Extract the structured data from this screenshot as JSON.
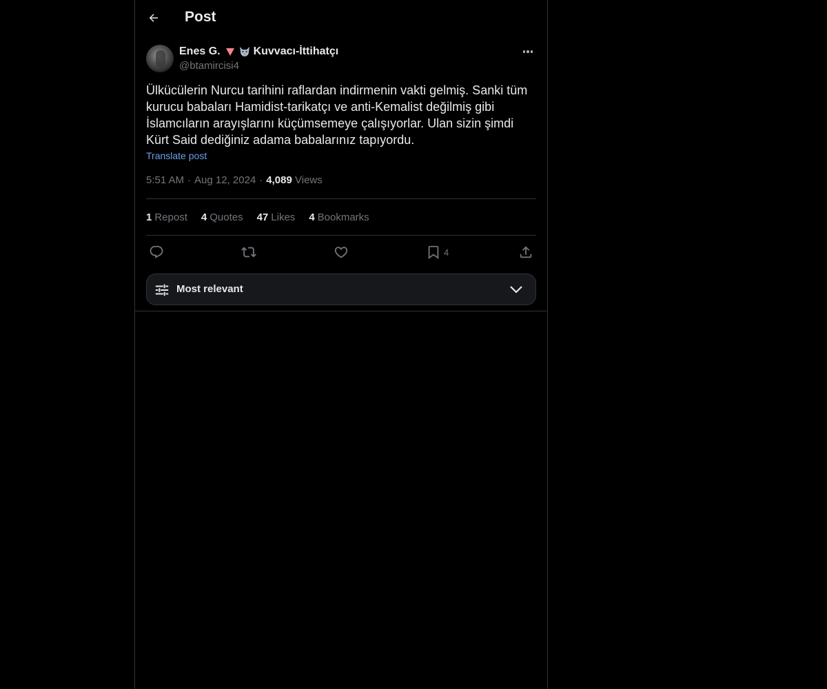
{
  "header": {
    "title": "Post"
  },
  "author": {
    "name": "Enes G.",
    "title_suffix": "Kuvvacı-İttihatçı",
    "handle": "@btamircisi4"
  },
  "post": {
    "text": "Ülkücülerin Nurcu tarihini raflardan indirmenin vakti gelmiş. Sanki tüm kurucu babaları Hamidist-tarikatçı ve anti-Kemalist değilmiş gibi İslamcıların arayışlarını küçümsemeye çalışıyorlar. Ulan sizin şimdi Kürt Said dediğiniz adama babalarınız tapıyordu.",
    "translate_label": "Translate post",
    "time": "5:51 AM",
    "date": "Aug 12, 2024",
    "views_count": "4,089",
    "views_label": "Views"
  },
  "stats": {
    "reposts_count": "1",
    "reposts_label": "Repost",
    "quotes_count": "4",
    "quotes_label": "Quotes",
    "likes_count": "47",
    "likes_label": "Likes",
    "bookmarks_count": "4",
    "bookmarks_label": "Bookmarks"
  },
  "actions": {
    "bookmark_count": "4"
  },
  "sort": {
    "label": "Most relevant"
  },
  "icons": {
    "back": "arrow-left-icon",
    "more": "more-horizontal-icon",
    "reply": "reply-icon",
    "repost": "repost-icon",
    "like": "heart-icon",
    "bookmark": "bookmark-icon",
    "share": "share-icon",
    "sort": "sliders-icon",
    "chevron": "chevron-down-icon"
  },
  "colors": {
    "background": "#000000",
    "text_primary": "#e7e9ea",
    "text_secondary": "#71767b",
    "link": "#6b9fe8",
    "border": "#2f3336"
  }
}
